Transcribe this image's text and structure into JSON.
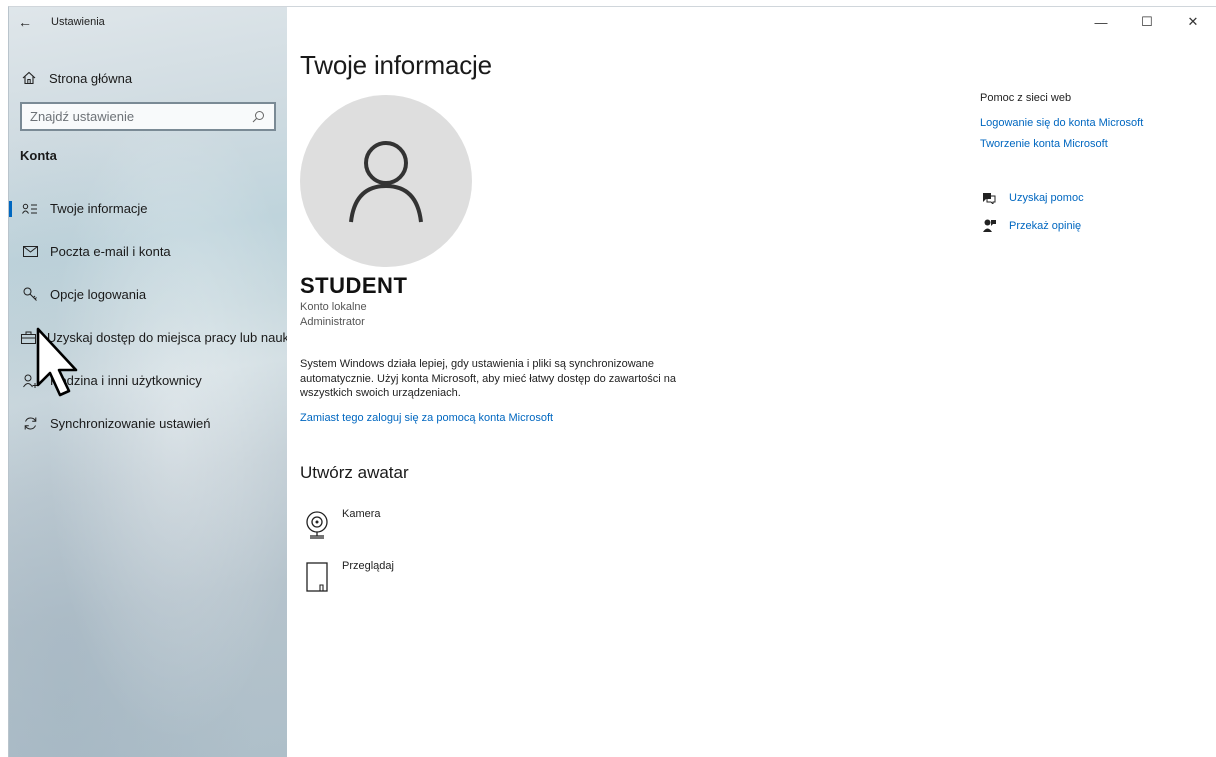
{
  "window": {
    "title": "Ustawienia",
    "back_glyph": "←",
    "minimize_glyph": "—",
    "maximize_glyph": "☐",
    "close_glyph": "✕"
  },
  "sidebar": {
    "home_label": "Strona główna",
    "search_placeholder": "Znajdź ustawienie",
    "section_title": "Konta",
    "items": [
      {
        "label": "Twoje informacje",
        "icon": "contact-card-icon",
        "active": true
      },
      {
        "label": "Poczta e-mail i konta",
        "icon": "mail-icon"
      },
      {
        "label": "Opcje logowania",
        "icon": "key-icon"
      },
      {
        "label": "Uzyskaj dostęp do miejsca pracy lub nauki",
        "icon": "briefcase-icon"
      },
      {
        "label": "Rodzina i inni użytkownicy",
        "icon": "add-person-icon"
      },
      {
        "label": "Synchronizowanie ustawień",
        "icon": "sync-icon"
      }
    ]
  },
  "main": {
    "title": "Twoje informacje",
    "user_name": "STUDENT",
    "account_type": "Konto lokalne",
    "account_role": "Administrator",
    "sync_text": "System Windows działa lepiej, gdy ustawienia i pliki są synchronizowane automatycznie. Użyj konta Microsoft, aby mieć łatwy dostęp do zawartości na wszystkich swoich urządzeniach.",
    "sync_link": "Zamiast tego zaloguj się za pomocą konta Microsoft",
    "avatar_heading": "Utwórz awatar",
    "avatar_options": [
      {
        "label": "Kamera",
        "icon": "webcam-icon"
      },
      {
        "label": "Przeglądaj",
        "icon": "file-browse-icon"
      }
    ]
  },
  "right": {
    "help_title": "Pomoc z sieci web",
    "links": [
      "Logowanie się do konta Microsoft",
      "Tworzenie konta Microsoft"
    ],
    "actions": [
      {
        "label": "Uzyskaj pomoc",
        "icon": "help-chat-icon"
      },
      {
        "label": "Przekaż opinię",
        "icon": "feedback-icon"
      }
    ]
  },
  "colors": {
    "accent": "#0067c0",
    "avatar_bg": "#dedede"
  }
}
